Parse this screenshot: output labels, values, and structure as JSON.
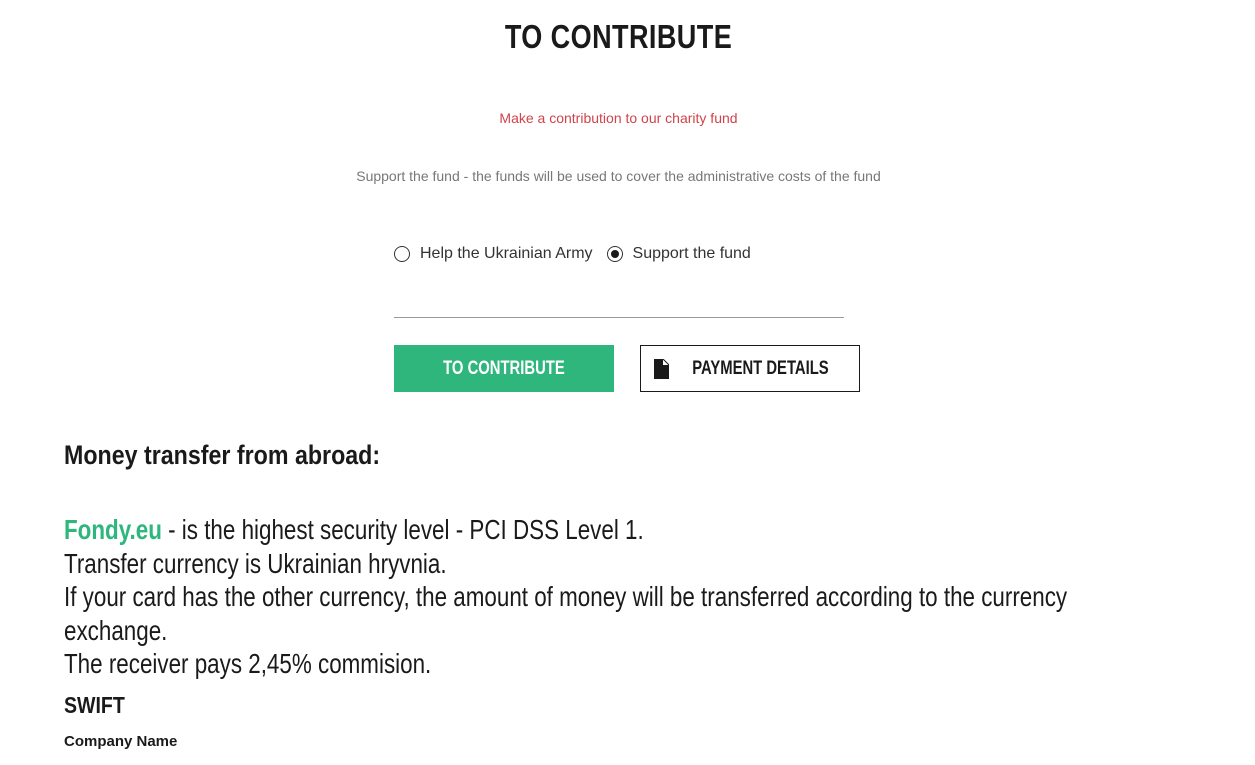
{
  "header": {
    "title": "TO CONTRIBUTE",
    "subtitle": "Make a contribution to our charity fund",
    "description": "Support the fund - the funds will be used to cover the administrative costs of the fund"
  },
  "form": {
    "options": [
      {
        "label": "Help the Ukrainian Army",
        "selected": false
      },
      {
        "label": "Support the fund",
        "selected": true
      }
    ],
    "amount": {
      "value": "",
      "placeholder": ""
    },
    "contribute_label": "TO CONTRIBUTE",
    "details_label": "PAYMENT DETAILS"
  },
  "transfer": {
    "heading": "Money transfer from abroad:",
    "fondy_link": "Fondy.eu",
    "line1_rest": " - is the highest security level - PCI DSS Level 1.",
    "line2": "Transfer currency is Ukrainian hryvnia.",
    "line3": "If your card has the other currency, the amount of money will be transferred according to the currency exchange.",
    "line4": "The receiver pays 2,45% commision.",
    "swift": "SWIFT",
    "company_name": "Company Name"
  },
  "colors": {
    "accent": "#2eb67d",
    "subtitle": "#d0434b",
    "text": "#1a1a1a",
    "muted": "#777777"
  }
}
